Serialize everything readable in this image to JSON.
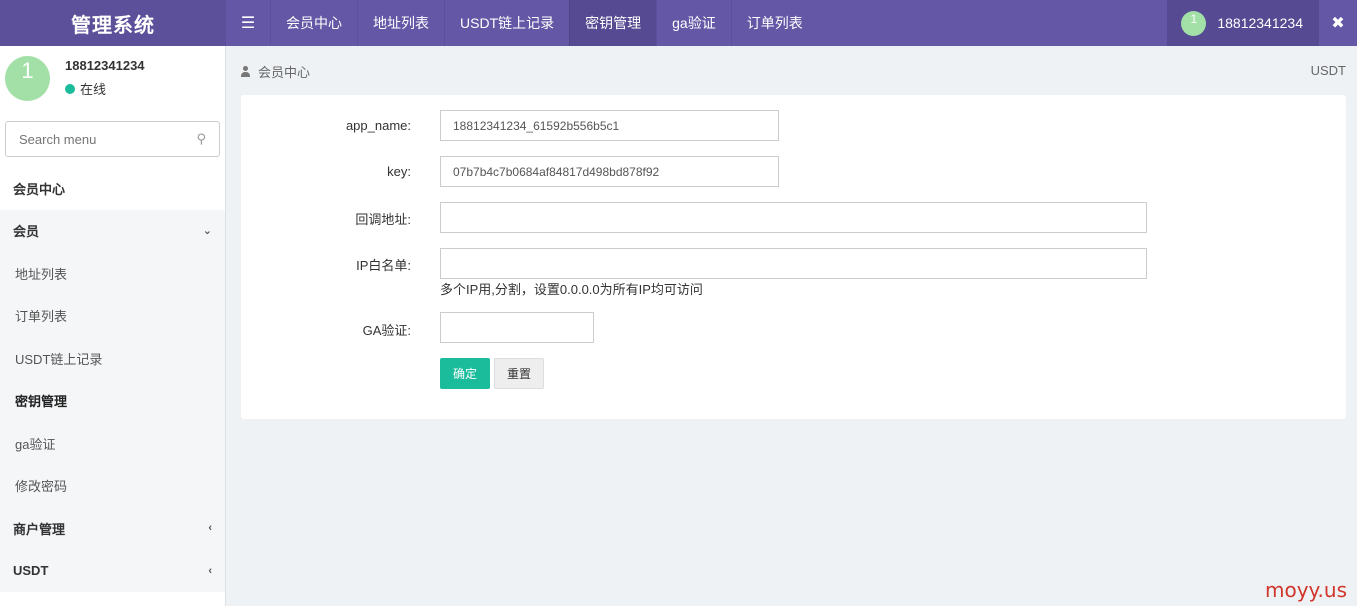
{
  "header": {
    "brand": "管理系统",
    "menu_icon": "hamburger-icon",
    "nav": [
      {
        "label": "会员中心",
        "active": false
      },
      {
        "label": "地址列表",
        "active": false
      },
      {
        "label": "USDT链上记录",
        "active": false
      },
      {
        "label": "密钥管理",
        "active": true
      },
      {
        "label": "ga验证",
        "active": false
      },
      {
        "label": "订单列表",
        "active": false
      }
    ],
    "user": {
      "avatar": "1",
      "name": "18812341234"
    },
    "expand_icon": "expand-icon"
  },
  "sidebar": {
    "user": {
      "avatar": "1",
      "name": "18812341234",
      "status": "在线",
      "status_color": "#1abc9c"
    },
    "search_placeholder": "Search menu",
    "items": [
      {
        "label": "会员中心",
        "type": "header"
      },
      {
        "label": "会员",
        "type": "parent",
        "chevron": "⌄"
      },
      {
        "label": "地址列表",
        "type": "sub"
      },
      {
        "label": "订单列表",
        "type": "sub"
      },
      {
        "label": "USDT链上记录",
        "type": "sub"
      },
      {
        "label": "密钥管理",
        "type": "sub",
        "active": true
      },
      {
        "label": "ga验证",
        "type": "sub"
      },
      {
        "label": "修改密码",
        "type": "sub"
      },
      {
        "label": "商户管理",
        "type": "parent",
        "chevron": "‹"
      },
      {
        "label": "USDT",
        "type": "parent",
        "chevron": "‹"
      }
    ]
  },
  "main": {
    "breadcrumb": "会员中心",
    "breadcrumb_right": "USDT",
    "form": {
      "app_name_label": "app_name:",
      "app_name_value": "18812341234_61592b556b5c1",
      "key_label": "key:",
      "key_value": "07b7b4c7b0684af84817d498bd878f92",
      "callback_label": "回调地址:",
      "callback_value": "",
      "ip_label": "IP白名单:",
      "ip_value": "",
      "ip_hint": "多个IP用,分割，设置0.0.0.0为所有IP均可访问",
      "ga_label": "GA验证:",
      "ga_value": "",
      "submit_label": "确定",
      "reset_label": "重置"
    }
  },
  "watermark": "moyy.us",
  "colors": {
    "topbar": "#6457a6",
    "accent": "#1abc9c"
  }
}
